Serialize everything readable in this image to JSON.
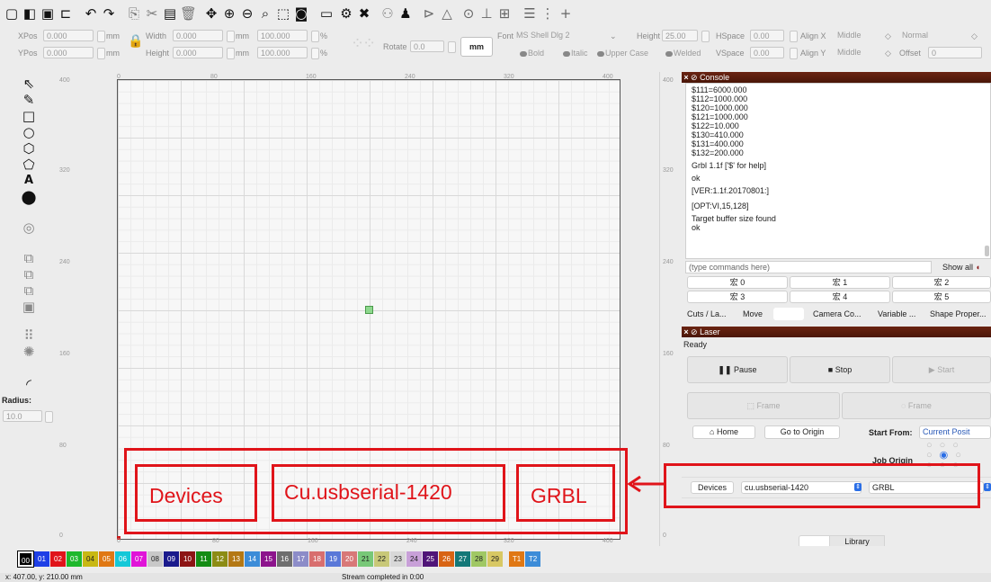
{
  "toolbar": {
    "icons": [
      "new-icon",
      "open-icon",
      "save-icon",
      "import-icon",
      "undo-icon",
      "redo-icon",
      "copy-icon",
      "cut-icon",
      "paste-icon",
      "delete-icon",
      "move-icon",
      "zoom-in-icon",
      "zoom-out-icon",
      "zoom-fit-icon",
      "select-frame-icon",
      "camera-icon",
      "monitor-icon",
      "settings-icon",
      "tools-icon",
      "users-icon",
      "user-icon",
      "mirror-h-icon",
      "mirror-v-icon",
      "target-icon",
      "align-icon",
      "distribute-icon",
      "grid-array-icon",
      "grid-snap-icon"
    ]
  },
  "props": {
    "xpos_label": "XPos",
    "xpos_value": "0.000",
    "ypos_label": "YPos",
    "ypos_value": "0.000",
    "mm1": "mm",
    "mm2": "mm",
    "width_label": "Width",
    "width_value": "0.000",
    "height_label": "Height",
    "height_value": "0.000",
    "mm3": "mm",
    "mm4": "mm",
    "pct_w": "100.000",
    "pct_h": "100.000",
    "pct1": "%",
    "pct2": "%",
    "rotate_label": "Rotate",
    "rotate_value": "0.0",
    "rotate_unit": "mm",
    "font_label": "Font",
    "font_value": "MS Shell Dlg 2",
    "fheight_label": "Height",
    "fheight_value": "25.00",
    "hspace_label": "HSpace",
    "hspace_value": "0.00",
    "vspace_label": "VSpace",
    "vspace_value": "0.00",
    "alignx_label": "Align X",
    "alignx_value": "Middle",
    "aligny_label": "Align Y",
    "aligny_value": "Middle",
    "normal_value": "Normal",
    "offset_label": "Offset",
    "offset_value": "0",
    "bold": "Bold",
    "italic": "Italic",
    "upper": "Upper Case",
    "welded": "Welded"
  },
  "left_tools": {
    "icons": [
      "select-icon",
      "pen-icon",
      "rectangle-icon",
      "ellipse-icon",
      "polygon-icon",
      "shape-icon",
      "text-icon",
      "position-icon",
      "offset-icon",
      "union-icon",
      "subtract-icon",
      "intersect-icon",
      "frame-icon",
      "array-icon",
      "circular-array-icon",
      "corner-icon"
    ],
    "radius_label": "Radius:",
    "radius_value": "10.0"
  },
  "ruler": {
    "top": [
      "0",
      "80",
      "160",
      "240",
      "320",
      "400"
    ],
    "left": [
      "400",
      "320",
      "240",
      "160",
      "80",
      "0"
    ],
    "bottom": [
      "0",
      "80",
      "160",
      "240",
      "320",
      "400"
    ],
    "right": [
      "400",
      "320",
      "240",
      "160",
      "80",
      "0"
    ]
  },
  "console": {
    "title": "Console",
    "lines": [
      "$111=6000.000",
      "$112=1000.000",
      "$120=1000.000",
      "$121=1000.000",
      "$122=10.000",
      "$130=410.000",
      "$131=400.000",
      "$132=200.000",
      "Grbl 1.1f ['$' for help]",
      "ok",
      "[VER:1.1f.20170801:]",
      "[OPT:VI,15,128]",
      "Target buffer size found",
      "ok"
    ],
    "input_placeholder": "(type commands here)",
    "show_all": "Show all",
    "macros": [
      "宏 0",
      "宏 1",
      "宏 2",
      "宏 3",
      "宏 4",
      "宏 5"
    ]
  },
  "tabs": [
    "Cuts / La...",
    "Move",
    "",
    "Camera Co...",
    "Variable ...",
    "Shape Proper..."
  ],
  "laser": {
    "title": "Laser",
    "status": "Ready",
    "pause": "Pause",
    "stop": "Stop",
    "start": "Start",
    "frame1": "Frame",
    "frame2": "Frame",
    "home": "Home",
    "go_origin": "Go to Origin",
    "start_from_label": "Start From:",
    "start_from_value": "Current Posit",
    "job_origin_label": "Job Origin",
    "devices": "Devices",
    "port": "cu.usbserial-1420",
    "controller": "GRBL",
    "library_tab": "Library"
  },
  "annotation": {
    "devices": "Devices",
    "port": "Cu.usbserial-1420",
    "controller": "GRBL"
  },
  "palette": {
    "swatches": [
      {
        "label": "00",
        "color": "#000000"
      },
      {
        "label": "01",
        "color": "#1e3fe6"
      },
      {
        "label": "02",
        "color": "#e0141a"
      },
      {
        "label": "03",
        "color": "#1eb82c"
      },
      {
        "label": "04",
        "color": "#c8b814"
      },
      {
        "label": "05",
        "color": "#e07814"
      },
      {
        "label": "06",
        "color": "#14c8d8"
      },
      {
        "label": "07",
        "color": "#e014d8"
      },
      {
        "label": "08",
        "color": "#c8c8c8"
      },
      {
        "label": "09",
        "color": "#1a1a8c"
      },
      {
        "label": "10",
        "color": "#8c1414"
      },
      {
        "label": "11",
        "color": "#148c14"
      },
      {
        "label": "12",
        "color": "#8c8c14"
      },
      {
        "label": "13",
        "color": "#b47814"
      },
      {
        "label": "14",
        "color": "#3c8cd8"
      },
      {
        "label": "15",
        "color": "#8c148c"
      },
      {
        "label": "16",
        "color": "#6e6e6e"
      },
      {
        "label": "17",
        "color": "#8c8cc8"
      },
      {
        "label": "18",
        "color": "#d86e6e"
      },
      {
        "label": "19",
        "color": "#5a78d8"
      },
      {
        "label": "20",
        "color": "#d87878"
      },
      {
        "label": "21",
        "color": "#78c878"
      },
      {
        "label": "22",
        "color": "#c8c878"
      },
      {
        "label": "23",
        "color": "#d8d8d8"
      },
      {
        "label": "24",
        "color": "#c8a0d8"
      },
      {
        "label": "25",
        "color": "#501478"
      },
      {
        "label": "26",
        "color": "#d86414"
      },
      {
        "label": "27",
        "color": "#147878"
      },
      {
        "label": "28",
        "color": "#a0c864"
      },
      {
        "label": "29",
        "color": "#d8c864"
      },
      {
        "label": "T1",
        "color": "#e07814"
      },
      {
        "label": "T2",
        "color": "#3c8cd8"
      }
    ]
  },
  "status": {
    "coords": "x: 407.00, y: 210.00 mm",
    "message": "Stream completed in 0:00"
  }
}
